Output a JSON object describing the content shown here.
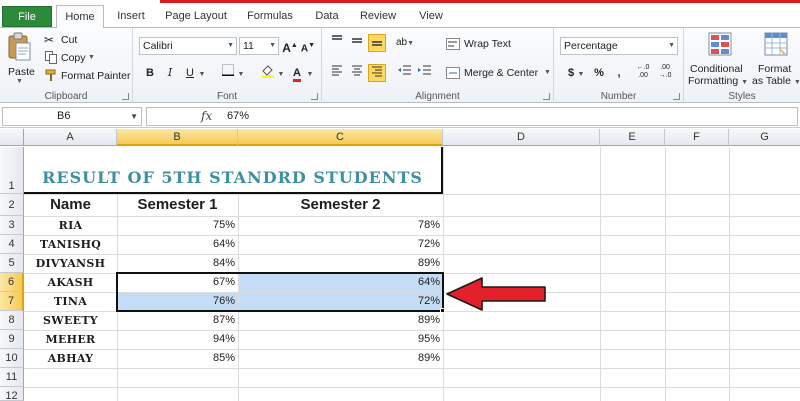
{
  "tabs": {
    "file": "File",
    "home": "Home",
    "insert": "Insert",
    "page_layout": "Page Layout",
    "formulas": "Formulas",
    "data": "Data",
    "review": "Review",
    "view": "View"
  },
  "ribbon": {
    "clipboard": {
      "paste": "Paste",
      "cut": "Cut",
      "copy": "Copy",
      "format_painter": "Format Painter",
      "label": "Clipboard"
    },
    "font": {
      "name": "Calibri",
      "size": "11",
      "bold": "B",
      "italic": "I",
      "underline": "U",
      "label": "Font"
    },
    "alignment": {
      "wrap_text": "Wrap Text",
      "merge_center": "Merge & Center",
      "label": "Alignment"
    },
    "number": {
      "format": "Percentage",
      "currency": "$",
      "percent": "%",
      "comma": ",",
      "label": "Number"
    },
    "styles": {
      "conditional_formatting_1": "Conditional",
      "conditional_formatting_2": "Formatting",
      "format_as_table_1": "Format",
      "format_as_table_2": "as Table",
      "label": "Styles"
    }
  },
  "formula_bar": {
    "name_box": "B6",
    "fx": "fx",
    "value": "67%"
  },
  "sheet": {
    "columns": [
      "A",
      "B",
      "C",
      "D",
      "E",
      "F",
      "G"
    ],
    "rows": [
      "1",
      "2",
      "3",
      "4",
      "5",
      "6",
      "7",
      "8",
      "9",
      "10",
      "11",
      "12"
    ],
    "title": "RESULT OF 5TH STANDRD STUDENTS",
    "headers": [
      "Name",
      "Semester 1",
      "Semester 2"
    ],
    "data": [
      {
        "name": "RIA",
        "s1": "75%",
        "s2": "78%"
      },
      {
        "name": "TANISHQ",
        "s1": "64%",
        "s2": "72%"
      },
      {
        "name": "DIVYANSH",
        "s1": "84%",
        "s2": "89%"
      },
      {
        "name": "AKASH",
        "s1": "67%",
        "s2": "64%"
      },
      {
        "name": "TINA",
        "s1": "76%",
        "s2": "72%"
      },
      {
        "name": "SWEETY",
        "s1": "87%",
        "s2": "89%"
      },
      {
        "name": "MEHER",
        "s1": "94%",
        "s2": "95%"
      },
      {
        "name": "ABHAY",
        "s1": "85%",
        "s2": "89%"
      }
    ],
    "active_cell": "B6",
    "selection": "B6:C7"
  },
  "colors": {
    "file_tab": "#2d8a3a",
    "title_text": "#3e8fa0",
    "selection_fill": "#c5dcf6",
    "arrow": "#e3212a",
    "header_highlight": "#f6c957"
  },
  "icons": [
    "paste-icon",
    "cut-icon",
    "copy-icon",
    "format-painter-icon",
    "conditional-formatting-icon",
    "format-as-table-icon",
    "red-arrow-annotation"
  ]
}
